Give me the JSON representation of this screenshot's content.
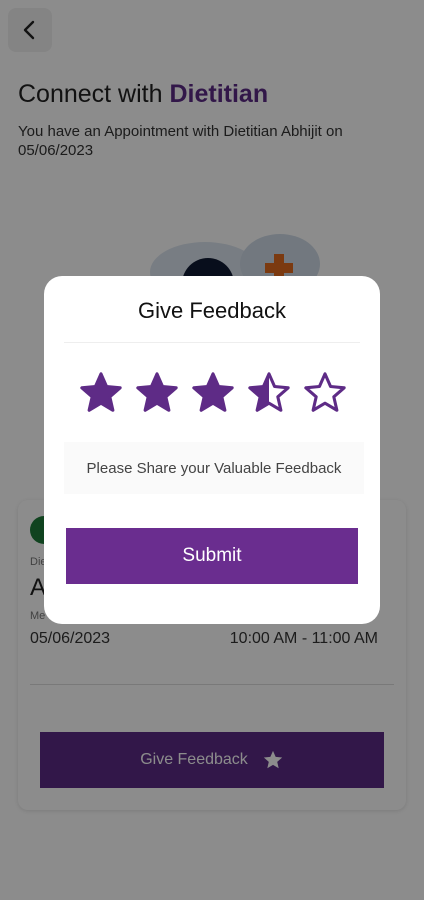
{
  "header": {
    "title_prefix": "Connect with ",
    "title_highlight": "Dietitian",
    "subtitle": "You have an Appointment with Dietitian Abhijit on 05/06/2023"
  },
  "appointment_card": {
    "role_label": "Die",
    "name_initial": "A",
    "mode_label": "Me",
    "date": "05/06/2023",
    "time": "10:00 AM - 11:00 AM",
    "feedback_button_label": "Give Feedback"
  },
  "modal": {
    "title": "Give Feedback",
    "rating": 3.5,
    "max_rating": 5,
    "input_placeholder": "Please Share your Valuable Feedback",
    "submit_label": "Submit"
  },
  "colors": {
    "accent": "#6a2d8f",
    "star": "#5e2b86",
    "card_icon": "#1e7a3a",
    "illustration_cross": "#e06a1e"
  },
  "icons": {
    "back": "back-arrow-icon",
    "star": "star-icon"
  }
}
